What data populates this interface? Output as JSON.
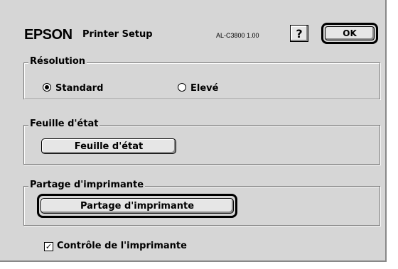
{
  "header": {
    "brand": "EPSON",
    "title": "Printer Setup",
    "model": "AL-C3800 1.00",
    "help_label": "?",
    "ok_label": "OK"
  },
  "resolution": {
    "label": "Résolution",
    "options": [
      {
        "label": "Standard",
        "selected": true
      },
      {
        "label": "Elevé",
        "selected": false
      }
    ]
  },
  "status_sheet": {
    "label": "Feuille d'état",
    "button_label": "Feuille d'état"
  },
  "printer_sharing": {
    "label": "Partage d'imprimante",
    "button_label": "Partage d'imprimante"
  },
  "printer_control": {
    "label": "Contrôle de l'imprimante",
    "checked": true,
    "check_glyph": "✓"
  }
}
